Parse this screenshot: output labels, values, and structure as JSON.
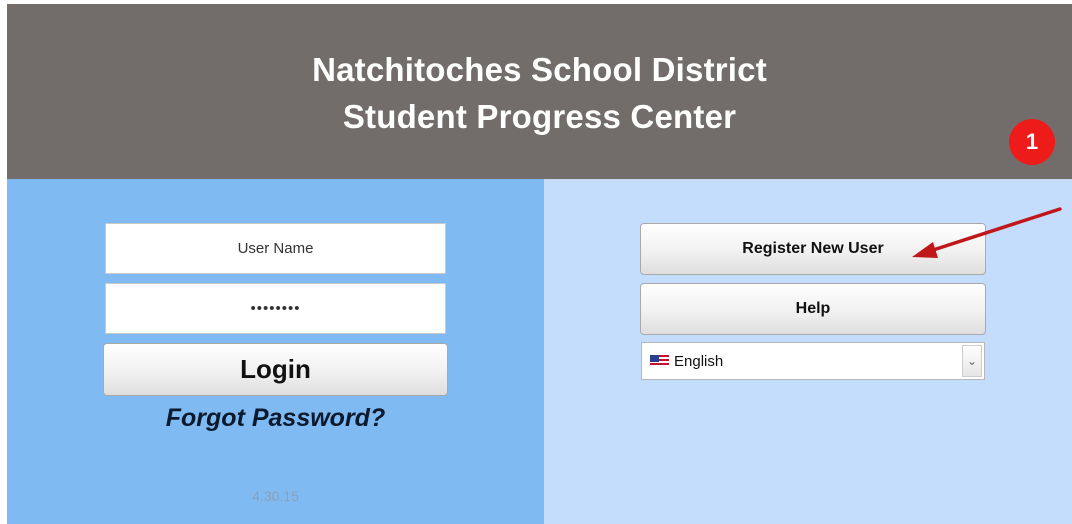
{
  "header": {
    "line1": "Natchitoches School District",
    "line2": "Student Progress Center"
  },
  "login": {
    "username_value": "User Name",
    "password_value": "••••••••",
    "login_label": "Login",
    "forgot_label": "Forgot Password?",
    "version": "4.30.15"
  },
  "actions": {
    "register_label": "Register New User",
    "help_label": "Help"
  },
  "language": {
    "selected": "English",
    "flag_icon": "us-flag-icon"
  },
  "annotation": {
    "badge_number": "1",
    "color": "#ee1b1b"
  },
  "colors": {
    "header_bg": "#726d6a",
    "left_panel_bg": "#80baf2",
    "right_panel_bg": "#c5ddfd"
  }
}
